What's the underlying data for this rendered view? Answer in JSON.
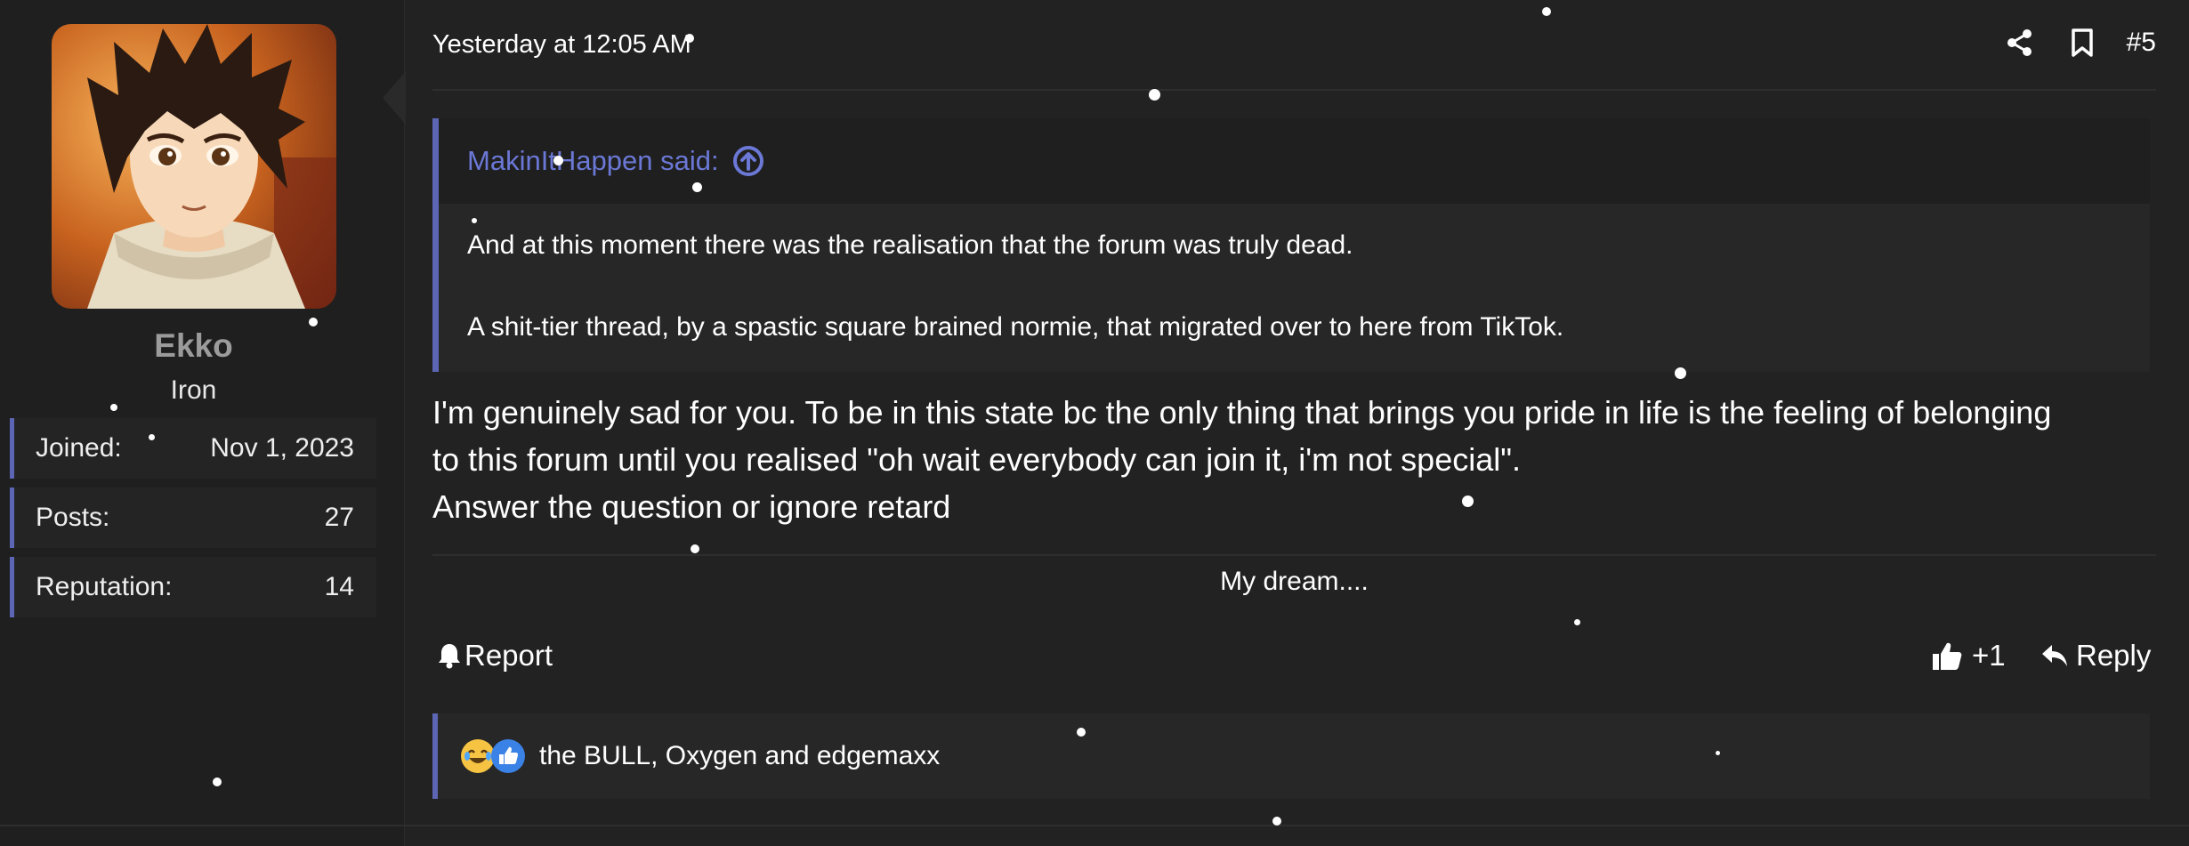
{
  "user": {
    "name": "Ekko",
    "title": "Iron",
    "stats": [
      {
        "label": "Joined:",
        "value": "Nov 1, 2023"
      },
      {
        "label": "Posts:",
        "value": "27"
      },
      {
        "label": "Reputation:",
        "value": "14"
      }
    ]
  },
  "post": {
    "date": "Yesterday at 12:05 AM",
    "number": "#5",
    "quote": {
      "author_line": "MakinItHappen said:",
      "lines": [
        "And at this moment there was the realisation that the forum was truly dead.",
        "A shit-tier thread, by a spastic square brained normie, that migrated over to here from TikTok."
      ]
    },
    "message_lines": [
      "I'm genuinely sad for you. To be in this state bc the only thing that brings you pride in life is the feeling of belonging",
      "to this forum until you realised \"oh wait everybody can join it, i'm not special\".",
      "Answer the question or ignore retard"
    ],
    "signature": "My dream....",
    "actions": {
      "report": "Report",
      "like": "+1",
      "reply": "Reply"
    },
    "reactions_text": "the BULL, Oxygen and edgemaxx"
  },
  "icons": {
    "share": "share-icon",
    "bookmark": "bookmark-icon",
    "quote_jump": "arrow-up-circle-icon",
    "report": "bell-icon",
    "like": "thumbs-up-icon",
    "reply": "reply-arrow-icon",
    "reaction_1": "laughing-emoji-icon",
    "reaction_2": "like-reaction-icon"
  },
  "colors": {
    "accent": "#5c66b5",
    "quote_author": "#6b78d6",
    "username": "#9b9b9b",
    "background": "#222222"
  }
}
